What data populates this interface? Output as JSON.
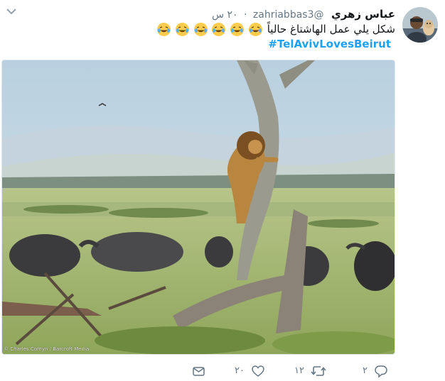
{
  "tweet": {
    "author_name": "عباس زهري",
    "author_handle": "@zahriabbas3",
    "separator": "·",
    "timestamp": "٢٠ س",
    "text": "شكل يلي عمل الهاشتاغ حالياً",
    "hashtag": "#TelAvivLovesBeirut",
    "media_credit": "© Charles Comyn / Barcroft Media",
    "media_description_icon": "lion-in-tree-photo"
  },
  "actions": {
    "reply_count": "٢",
    "retweet_count": "١٢",
    "like_count": "٢٠"
  },
  "colors": {
    "link": "#1da1f2",
    "muted": "#657786",
    "text": "#14171a"
  }
}
